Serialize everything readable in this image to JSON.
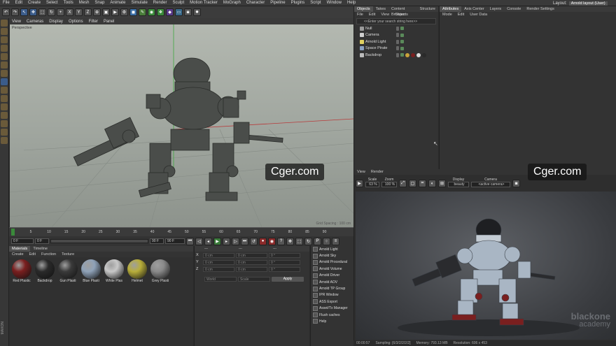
{
  "menu": [
    "File",
    "Edit",
    "Create",
    "Select",
    "Tools",
    "Mesh",
    "Snap",
    "Animate",
    "Simulate",
    "Render",
    "Sculpt",
    "Motion Tracker",
    "MoGraph",
    "Character",
    "Pipeline",
    "Plugins",
    "Script",
    "Window",
    "Help"
  ],
  "layout_label": "Layout:",
  "layout_value": "Arnold layout (User)",
  "viewport_menu": [
    "View",
    "Cameras",
    "Display",
    "Options",
    "Filter",
    "Panel"
  ],
  "viewport_label": "Perspective",
  "grid_spacing": "Grid Spacing : 100 cm",
  "ruler": [
    "0",
    "5",
    "10",
    "15",
    "20",
    "25",
    "30",
    "35",
    "40",
    "45",
    "50",
    "55",
    "60",
    "65",
    "70",
    "75",
    "80",
    "85",
    "90"
  ],
  "time_start": "0 F",
  "time_cur": "0 F",
  "time_end": "90 F",
  "time_end2": "90 F",
  "time_frame": "0 F",
  "mat_tabs": [
    "Materials",
    "Timeline"
  ],
  "mat_menu": [
    "Create",
    "Edit",
    "Function",
    "Texture"
  ],
  "materials": [
    {
      "name": "Red Plastic",
      "color": "#7a1f1f"
    },
    {
      "name": "Backdrop",
      "color": "#2a2a2a"
    },
    {
      "name": "Gun Plasti",
      "color": "#3a3a3a"
    },
    {
      "name": "Blue Plasti",
      "color": "#8fa2b8"
    },
    {
      "name": "White Plas",
      "color": "#c8c8c8"
    },
    {
      "name": "Helmet",
      "color": "#b8ae3a"
    },
    {
      "name": "Grey Plasti",
      "color": "#8a8a8a"
    }
  ],
  "coords": {
    "headers": [
      "---",
      "---",
      "---"
    ],
    "rows": [
      {
        "axis": "X",
        "a": "0 cm",
        "b": "0 cm",
        "c": "0 °"
      },
      {
        "axis": "Y",
        "a": "0 cm",
        "b": "0 cm",
        "c": "0 °"
      },
      {
        "axis": "Z",
        "a": "0 cm",
        "b": "0 cm",
        "c": "0 °"
      }
    ],
    "mode1": "World",
    "mode2": "Scale",
    "apply": "Apply"
  },
  "arnold_menu": [
    "Arnold Light",
    "Arnold Sky",
    "Arnold Procedural",
    "Arnold Volume",
    "Arnold Driver",
    "Arnold AOV",
    "Arnold TP Group",
    "IPR Window",
    "ASS Export",
    "Asset/Tx Manager",
    "Flush caches",
    "Help"
  ],
  "obj_tabs": [
    "Objects",
    "Takes",
    "Content Browser",
    "Structure"
  ],
  "obj_menu": [
    "File",
    "Edit",
    "View",
    "Objects"
  ],
  "obj_search": "<<Enter your search string here>>",
  "objects": [
    "Null",
    "Camera",
    "Arnold Light",
    "Space Pirate",
    "Backdrop"
  ],
  "attr_tabs": [
    "Attributes",
    "Axis Center",
    "Layers",
    "Console",
    "Render Settings"
  ],
  "attr_menu": [
    "Mode",
    "Edit",
    "User Data"
  ],
  "ipr_menu": [
    "View",
    "Render"
  ],
  "ipr": {
    "scale_label": "Scale",
    "scale": "63 %",
    "zoom_label": "Zoom",
    "zoom": "100 %",
    "display_label": "Display",
    "display": "beauty",
    "camera_label": "Camera",
    "camera": "<active camera>"
  },
  "watermark": "Cger.com",
  "logo_line1": "blackone",
  "logo_line2": "academy",
  "status": {
    "time": "00:00:57",
    "sampling": "Sampling: [6/3/2/2/2/2]",
    "memory": "Memory: 793.13 MB",
    "resolution": "Resolution: 606 x 453"
  },
  "maxon": "MAXON"
}
